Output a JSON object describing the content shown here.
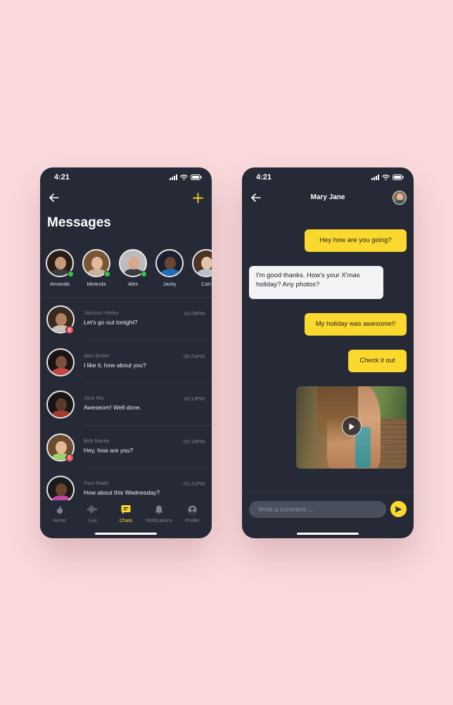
{
  "colors": {
    "background": "#fadadd",
    "phone_bg": "#252a36",
    "accent": "#fbd82d",
    "online": "#36c24a",
    "badge": "#ea4d5c",
    "incoming_bubble": "#f4f4f6"
  },
  "left_screen": {
    "status_time": "4:21",
    "title": "Messages",
    "stories": [
      {
        "name": "Amanda",
        "online": true,
        "skin": "#c79a78",
        "hair": "#2a1d16",
        "shirt": "#3c3c3c"
      },
      {
        "name": "Miranda",
        "online": true,
        "skin": "#e2b99c",
        "hair": "#7a5636",
        "shirt": "#c9b39a"
      },
      {
        "name": "Alex",
        "online": true,
        "skin": "#d9a88c",
        "hair": "#bcbcbc",
        "shirt": "#3b3b40"
      },
      {
        "name": "Jacky",
        "online": false,
        "skin": "#6b4532",
        "hair": "#1c2030",
        "shirt": "#1e6fb8"
      },
      {
        "name": "Carl",
        "online": false,
        "skin": "#e7c3a8",
        "hair": "#4a3526",
        "shirt": "#b6c3cc"
      }
    ],
    "chats": [
      {
        "name": "Jackson Moley",
        "message": "Let's go out tonight?",
        "time": "10:24PM",
        "badge": "2",
        "skin": "#b3805e",
        "hair": "#3a2a20",
        "shirt": "#c9c2b8"
      },
      {
        "name": "Alex Bober",
        "message": "I like it, how about you?",
        "time": "05:23PM",
        "badge": "",
        "skin": "#7a5140",
        "hair": "#1a1414",
        "shirt": "#c2473e"
      },
      {
        "name": "Jack Ma",
        "message": "Aweseom! Well done.",
        "time": "10:13PM",
        "badge": "",
        "skin": "#5a3a2c",
        "hair": "#161616",
        "shirt": "#a33a30"
      },
      {
        "name": "Bob Marke",
        "message": "Hey, how are you?",
        "time": "02:18PM",
        "badge": "1",
        "skin": "#e5b894",
        "hair": "#6b4c2e",
        "shirt": "#9fd06a"
      },
      {
        "name": "Paul Radd",
        "message": "How about this Wednesday?",
        "time": "01:41PM",
        "badge": "",
        "skin": "#6a4232",
        "hair": "#1b1b1b",
        "shirt": "#c347a0"
      }
    ],
    "tabs": [
      {
        "label": "Home",
        "icon": "flame-icon",
        "active": false
      },
      {
        "label": "Live",
        "icon": "waveform-icon",
        "active": false
      },
      {
        "label": "Chats",
        "icon": "chat-bubble-icon",
        "active": true
      },
      {
        "label": "Notifications",
        "icon": "bell-icon",
        "active": false
      },
      {
        "label": "Profile",
        "icon": "profile-icon",
        "active": false
      }
    ]
  },
  "right_screen": {
    "status_time": "4:21",
    "contact_name": "Mary Jane",
    "messages": [
      {
        "direction": "out",
        "text": "Hey how are you going?"
      },
      {
        "direction": "in",
        "text": "I'm good thanks. How's your X'mas holiday? Any photos?"
      },
      {
        "direction": "out",
        "text": "My holiday was awesome!!"
      },
      {
        "direction": "out",
        "text": "Check it out"
      },
      {
        "direction": "out",
        "type": "video",
        "icon": "play-icon"
      }
    ],
    "composer_placeholder": "Write a comment ..."
  }
}
